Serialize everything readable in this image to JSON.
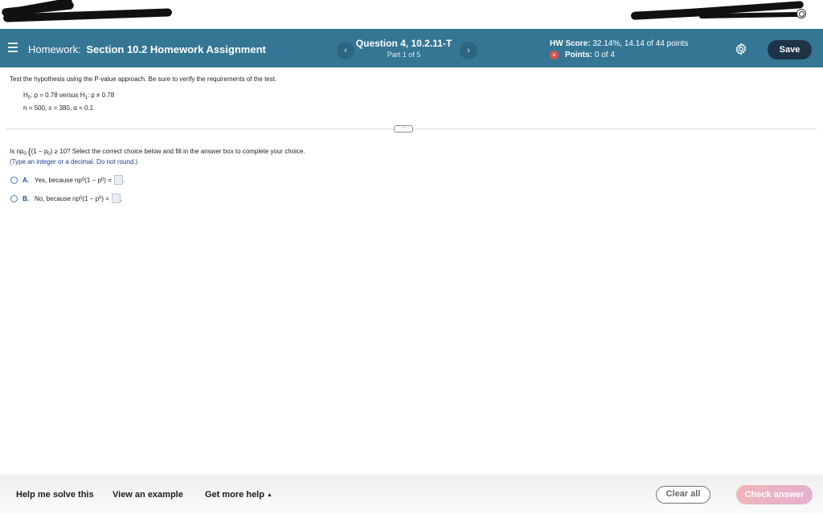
{
  "header": {
    "menu_icon": "hamburger-icon",
    "prefix": "Homework:",
    "title": "Section 10.2 Homework Assignment",
    "question_title": "Question 4, 10.2.11-T",
    "question_part": "Part 1 of 5",
    "prev_icon": "‹",
    "next_icon": "›",
    "hw_score_label": "HW Score:",
    "hw_score_value": "32.14%, 14.14 of 44 points",
    "points_label": "Points:",
    "points_value": "0 of 4",
    "points_status_icon": "×",
    "settings_icon": "gear-icon",
    "save_label": "Save"
  },
  "problem": {
    "instructions": "Test the hypothesis using the P-value approach. Be sure to verify the requirements of the test.",
    "h0_label": "H",
    "h0_sub": "0",
    "h0_text": ": p = 0.78 versus H",
    "h1_sub": "1",
    "h1_text": ": p ≠ 0.78",
    "given": "n = 500, x = 380, α = 0.1",
    "handle_label": "⋯"
  },
  "question": {
    "prefix": "Is np",
    "sub0": "0",
    "mid": "(1 − p",
    "sub1": "0",
    "suffix": ") ≥ 10? Select the correct choice below and fill in the answer box to complete your choice.",
    "hint": "(Type an integer or a decimal. Do not round.)",
    "choices": [
      {
        "letter": "A.",
        "text": "Yes, because np",
        "sub": "0",
        "expr": " (1 − p",
        "sub2": "0",
        "end": ") =",
        "value": ""
      },
      {
        "letter": "B.",
        "text": "No, because np",
        "sub": "0",
        "expr": " (1 − p",
        "sub2": "0",
        "end": ") =",
        "value": ""
      }
    ]
  },
  "footer": {
    "help_solve": "Help me solve this",
    "view_example": "View an example",
    "more_help": "Get more help",
    "more_help_caret": "▲",
    "clear_all": "Clear all",
    "check_answer": "Check answer"
  },
  "colors": {
    "header_bg": "#347694",
    "save_bg": "#1e3347",
    "check_answer_bg": "#f0b5b8",
    "hint_text": "#1a3c8c",
    "error_icon": "#d9534f"
  }
}
